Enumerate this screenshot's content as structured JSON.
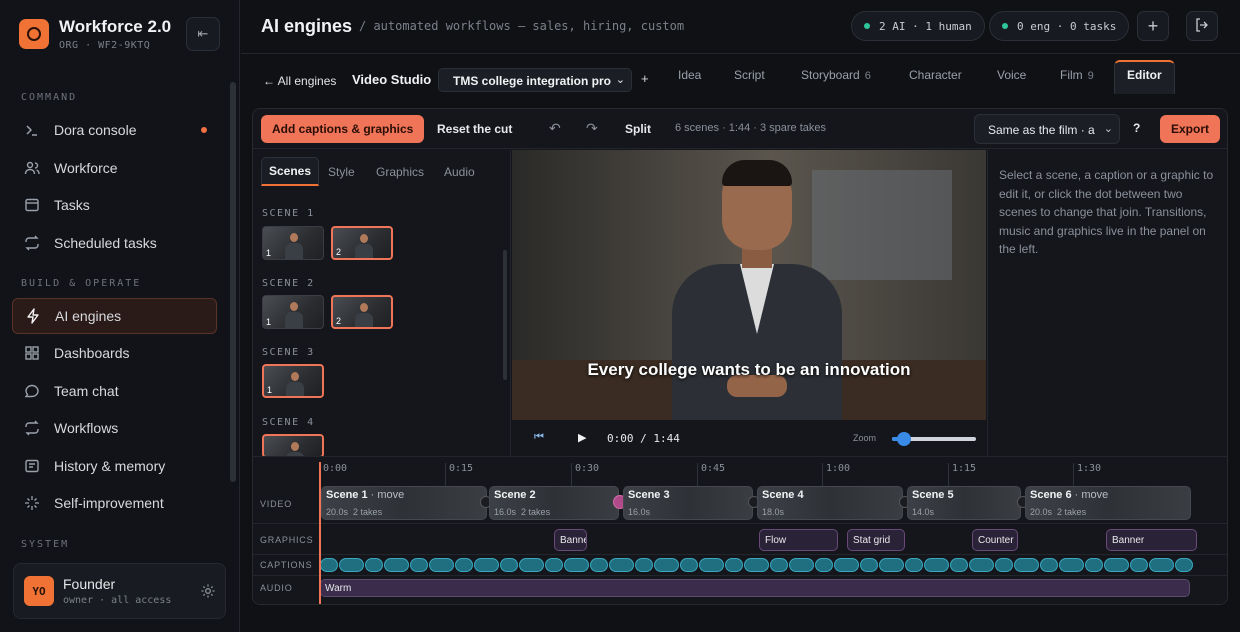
{
  "app": {
    "name": "Workforce 2.0",
    "org": "ORG · WF2-9KTQ"
  },
  "sidebar": {
    "sections": {
      "command": "COMMAND",
      "build": "BUILD & OPERATE",
      "system": "SYSTEM"
    },
    "items": [
      {
        "label": "Dora console",
        "icon": "terminal-icon"
      },
      {
        "label": "Workforce",
        "icon": "users-icon"
      },
      {
        "label": "Tasks",
        "icon": "tasks-icon"
      },
      {
        "label": "Scheduled tasks",
        "icon": "repeat-icon"
      },
      {
        "label": "AI engines",
        "icon": "bolt-icon"
      },
      {
        "label": "Dashboards",
        "icon": "grid-icon"
      },
      {
        "label": "Team chat",
        "icon": "chat-icon"
      },
      {
        "label": "Workflows",
        "icon": "workflow-icon"
      },
      {
        "label": "History & memory",
        "icon": "history-icon"
      },
      {
        "label": "Self-improvement",
        "icon": "sparkle-icon"
      }
    ],
    "user": {
      "initials": "YO",
      "name": "Founder",
      "role": "owner · all access"
    }
  },
  "header": {
    "title": "AI engines",
    "subtitle": "/ automated workflows — sales, hiring, custom",
    "ai_pill": "2 AI · 1 human",
    "eng_pill": "0 eng · 0 tasks",
    "accent": "#f07335"
  },
  "subnav": {
    "back": "← All engines",
    "studio": "Video Studio",
    "project": "TMS college integration pro",
    "tabs": [
      {
        "label": "Idea",
        "count": ""
      },
      {
        "label": "Script",
        "count": ""
      },
      {
        "label": "Storyboard",
        "count": "6"
      },
      {
        "label": "Character",
        "count": ""
      },
      {
        "label": "Voice",
        "count": ""
      },
      {
        "label": "Film",
        "count": "9"
      },
      {
        "label": "Editor",
        "count": ""
      }
    ]
  },
  "toolbar": {
    "add_captions": "Add captions & graphics",
    "reset": "Reset the cut",
    "split": "Split",
    "info": "6 scenes · 1:44 · 3 spare takes",
    "select": "Same as the film · a",
    "help": "?",
    "export": "Export"
  },
  "left_panel": {
    "tabs": [
      "Scenes",
      "Style",
      "Graphics",
      "Audio"
    ],
    "scenes": [
      {
        "label": "SCENE 1",
        "takes": [
          "1",
          "2"
        ]
      },
      {
        "label": "SCENE 2",
        "takes": [
          "1",
          "2"
        ]
      },
      {
        "label": "SCENE 3",
        "takes": [
          "1"
        ]
      },
      {
        "label": "SCENE 4",
        "takes": [
          ""
        ]
      }
    ]
  },
  "video": {
    "caption": "Every college wants to be an innovation",
    "time": "0:00 / 1:44",
    "zoom_label": "Zoom"
  },
  "help_text": "Select a scene, a caption or a graphic to edit it, or click the dot between two scenes to change that join. Transitions, music and graphics live in the panel on the left.",
  "timeline": {
    "ticks": [
      "0:00",
      "0:15",
      "0:30",
      "0:45",
      "1:00",
      "1:15",
      "1:30"
    ],
    "rows": [
      "VIDEO",
      "GRAPHICS",
      "CAPTIONS",
      "AUDIO"
    ],
    "clips": [
      {
        "title": "Scene 1",
        "suffix": " · move",
        "dur": "20.0s",
        "takes": "2 takes"
      },
      {
        "title": "Scene 2",
        "suffix": "",
        "dur": "16.0s",
        "takes": "2 takes"
      },
      {
        "title": "Scene 3",
        "suffix": "",
        "dur": "16.0s",
        "takes": ""
      },
      {
        "title": "Scene 4",
        "suffix": "",
        "dur": "18.0s",
        "takes": ""
      },
      {
        "title": "Scene 5",
        "suffix": "",
        "dur": "14.0s",
        "takes": ""
      },
      {
        "title": "Scene 6",
        "suffix": " · move",
        "dur": "20.0s",
        "takes": "2 takes"
      }
    ],
    "graphics": [
      "Banne",
      "Flow",
      "Stat grid",
      "Counter",
      "Banner"
    ],
    "audio": "Warm"
  }
}
